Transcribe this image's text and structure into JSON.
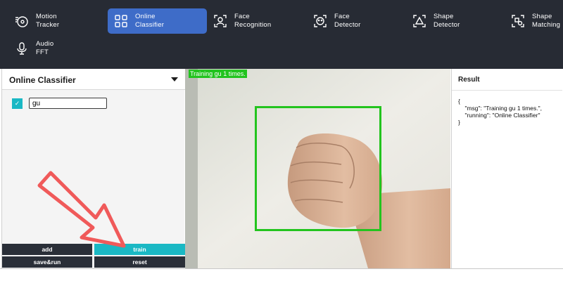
{
  "nav": {
    "items": [
      {
        "label": "Motion\nTracker",
        "icon": "motion-tracker-icon"
      },
      {
        "label": "Online\nClassifier",
        "icon": "grid-classifier-icon",
        "active": true
      },
      {
        "label": "Face\nRecognition",
        "icon": "face-recognition-icon"
      },
      {
        "label": "Face\nDetector",
        "icon": "face-detector-icon"
      },
      {
        "label": "Shape\nDetector",
        "icon": "shape-detector-icon"
      },
      {
        "label": "Shape\nMatching",
        "icon": "shape-matching-icon"
      },
      {
        "label": "Audio\nFFT",
        "icon": "microphone-icon"
      }
    ]
  },
  "left_panel": {
    "title": "Online Classifier",
    "class_input_value": "gu",
    "checkbox_mark": "✓",
    "buttons": {
      "add": "add",
      "train": "train",
      "save_run": "save&run",
      "reset": "reset"
    }
  },
  "camera": {
    "overlay_text": "Training gu 1 times."
  },
  "result": {
    "title": "Result",
    "body": "{\n    \"msg\": \"Training gu 1 times.\",\n    \"running\": \"Online Classifier\"\n}"
  },
  "colors": {
    "topbar": "#272b34",
    "active_nav": "#3e6cc8",
    "teal": "#1ab8c4",
    "detect_green": "#23c41e",
    "arrow_red": "#f05a5a"
  }
}
